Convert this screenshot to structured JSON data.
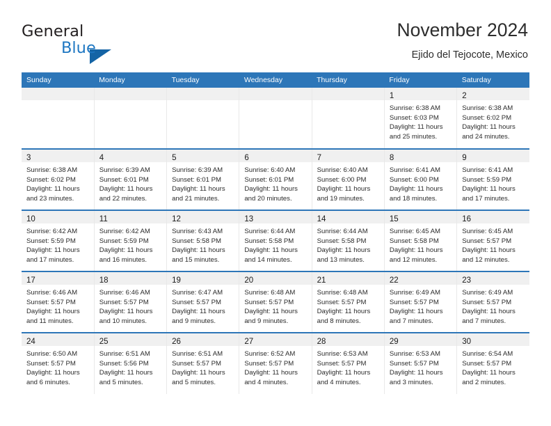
{
  "logo": {
    "word1": "General",
    "word2": "Blue",
    "triangle_color": "#1464a5",
    "blue_color": "#1e77c2"
  },
  "header": {
    "title": "November 2024",
    "subtitle": "Ejido del Tejocote, Mexico"
  },
  "theme": {
    "header_bg": "#2d76b8",
    "daynum_band": "#f0f0f0",
    "row_border": "#2d76b8"
  },
  "weekday_headers": [
    "Sunday",
    "Monday",
    "Tuesday",
    "Wednesday",
    "Thursday",
    "Friday",
    "Saturday"
  ],
  "weeks": [
    [
      {
        "day": "",
        "sunrise": "",
        "sunset": "",
        "daylight_line1": "",
        "daylight_line2": ""
      },
      {
        "day": "",
        "sunrise": "",
        "sunset": "",
        "daylight_line1": "",
        "daylight_line2": ""
      },
      {
        "day": "",
        "sunrise": "",
        "sunset": "",
        "daylight_line1": "",
        "daylight_line2": ""
      },
      {
        "day": "",
        "sunrise": "",
        "sunset": "",
        "daylight_line1": "",
        "daylight_line2": ""
      },
      {
        "day": "",
        "sunrise": "",
        "sunset": "",
        "daylight_line1": "",
        "daylight_line2": ""
      },
      {
        "day": "1",
        "sunrise": "Sunrise: 6:38 AM",
        "sunset": "Sunset: 6:03 PM",
        "daylight_line1": "Daylight: 11 hours",
        "daylight_line2": "and 25 minutes."
      },
      {
        "day": "2",
        "sunrise": "Sunrise: 6:38 AM",
        "sunset": "Sunset: 6:02 PM",
        "daylight_line1": "Daylight: 11 hours",
        "daylight_line2": "and 24 minutes."
      }
    ],
    [
      {
        "day": "3",
        "sunrise": "Sunrise: 6:38 AM",
        "sunset": "Sunset: 6:02 PM",
        "daylight_line1": "Daylight: 11 hours",
        "daylight_line2": "and 23 minutes."
      },
      {
        "day": "4",
        "sunrise": "Sunrise: 6:39 AM",
        "sunset": "Sunset: 6:01 PM",
        "daylight_line1": "Daylight: 11 hours",
        "daylight_line2": "and 22 minutes."
      },
      {
        "day": "5",
        "sunrise": "Sunrise: 6:39 AM",
        "sunset": "Sunset: 6:01 PM",
        "daylight_line1": "Daylight: 11 hours",
        "daylight_line2": "and 21 minutes."
      },
      {
        "day": "6",
        "sunrise": "Sunrise: 6:40 AM",
        "sunset": "Sunset: 6:01 PM",
        "daylight_line1": "Daylight: 11 hours",
        "daylight_line2": "and 20 minutes."
      },
      {
        "day": "7",
        "sunrise": "Sunrise: 6:40 AM",
        "sunset": "Sunset: 6:00 PM",
        "daylight_line1": "Daylight: 11 hours",
        "daylight_line2": "and 19 minutes."
      },
      {
        "day": "8",
        "sunrise": "Sunrise: 6:41 AM",
        "sunset": "Sunset: 6:00 PM",
        "daylight_line1": "Daylight: 11 hours",
        "daylight_line2": "and 18 minutes."
      },
      {
        "day": "9",
        "sunrise": "Sunrise: 6:41 AM",
        "sunset": "Sunset: 5:59 PM",
        "daylight_line1": "Daylight: 11 hours",
        "daylight_line2": "and 17 minutes."
      }
    ],
    [
      {
        "day": "10",
        "sunrise": "Sunrise: 6:42 AM",
        "sunset": "Sunset: 5:59 PM",
        "daylight_line1": "Daylight: 11 hours",
        "daylight_line2": "and 17 minutes."
      },
      {
        "day": "11",
        "sunrise": "Sunrise: 6:42 AM",
        "sunset": "Sunset: 5:59 PM",
        "daylight_line1": "Daylight: 11 hours",
        "daylight_line2": "and 16 minutes."
      },
      {
        "day": "12",
        "sunrise": "Sunrise: 6:43 AM",
        "sunset": "Sunset: 5:58 PM",
        "daylight_line1": "Daylight: 11 hours",
        "daylight_line2": "and 15 minutes."
      },
      {
        "day": "13",
        "sunrise": "Sunrise: 6:44 AM",
        "sunset": "Sunset: 5:58 PM",
        "daylight_line1": "Daylight: 11 hours",
        "daylight_line2": "and 14 minutes."
      },
      {
        "day": "14",
        "sunrise": "Sunrise: 6:44 AM",
        "sunset": "Sunset: 5:58 PM",
        "daylight_line1": "Daylight: 11 hours",
        "daylight_line2": "and 13 minutes."
      },
      {
        "day": "15",
        "sunrise": "Sunrise: 6:45 AM",
        "sunset": "Sunset: 5:58 PM",
        "daylight_line1": "Daylight: 11 hours",
        "daylight_line2": "and 12 minutes."
      },
      {
        "day": "16",
        "sunrise": "Sunrise: 6:45 AM",
        "sunset": "Sunset: 5:57 PM",
        "daylight_line1": "Daylight: 11 hours",
        "daylight_line2": "and 12 minutes."
      }
    ],
    [
      {
        "day": "17",
        "sunrise": "Sunrise: 6:46 AM",
        "sunset": "Sunset: 5:57 PM",
        "daylight_line1": "Daylight: 11 hours",
        "daylight_line2": "and 11 minutes."
      },
      {
        "day": "18",
        "sunrise": "Sunrise: 6:46 AM",
        "sunset": "Sunset: 5:57 PM",
        "daylight_line1": "Daylight: 11 hours",
        "daylight_line2": "and 10 minutes."
      },
      {
        "day": "19",
        "sunrise": "Sunrise: 6:47 AM",
        "sunset": "Sunset: 5:57 PM",
        "daylight_line1": "Daylight: 11 hours",
        "daylight_line2": "and 9 minutes."
      },
      {
        "day": "20",
        "sunrise": "Sunrise: 6:48 AM",
        "sunset": "Sunset: 5:57 PM",
        "daylight_line1": "Daylight: 11 hours",
        "daylight_line2": "and 9 minutes."
      },
      {
        "day": "21",
        "sunrise": "Sunrise: 6:48 AM",
        "sunset": "Sunset: 5:57 PM",
        "daylight_line1": "Daylight: 11 hours",
        "daylight_line2": "and 8 minutes."
      },
      {
        "day": "22",
        "sunrise": "Sunrise: 6:49 AM",
        "sunset": "Sunset: 5:57 PM",
        "daylight_line1": "Daylight: 11 hours",
        "daylight_line2": "and 7 minutes."
      },
      {
        "day": "23",
        "sunrise": "Sunrise: 6:49 AM",
        "sunset": "Sunset: 5:57 PM",
        "daylight_line1": "Daylight: 11 hours",
        "daylight_line2": "and 7 minutes."
      }
    ],
    [
      {
        "day": "24",
        "sunrise": "Sunrise: 6:50 AM",
        "sunset": "Sunset: 5:57 PM",
        "daylight_line1": "Daylight: 11 hours",
        "daylight_line2": "and 6 minutes."
      },
      {
        "day": "25",
        "sunrise": "Sunrise: 6:51 AM",
        "sunset": "Sunset: 5:56 PM",
        "daylight_line1": "Daylight: 11 hours",
        "daylight_line2": "and 5 minutes."
      },
      {
        "day": "26",
        "sunrise": "Sunrise: 6:51 AM",
        "sunset": "Sunset: 5:57 PM",
        "daylight_line1": "Daylight: 11 hours",
        "daylight_line2": "and 5 minutes."
      },
      {
        "day": "27",
        "sunrise": "Sunrise: 6:52 AM",
        "sunset": "Sunset: 5:57 PM",
        "daylight_line1": "Daylight: 11 hours",
        "daylight_line2": "and 4 minutes."
      },
      {
        "day": "28",
        "sunrise": "Sunrise: 6:53 AM",
        "sunset": "Sunset: 5:57 PM",
        "daylight_line1": "Daylight: 11 hours",
        "daylight_line2": "and 4 minutes."
      },
      {
        "day": "29",
        "sunrise": "Sunrise: 6:53 AM",
        "sunset": "Sunset: 5:57 PM",
        "daylight_line1": "Daylight: 11 hours",
        "daylight_line2": "and 3 minutes."
      },
      {
        "day": "30",
        "sunrise": "Sunrise: 6:54 AM",
        "sunset": "Sunset: 5:57 PM",
        "daylight_line1": "Daylight: 11 hours",
        "daylight_line2": "and 2 minutes."
      }
    ]
  ]
}
